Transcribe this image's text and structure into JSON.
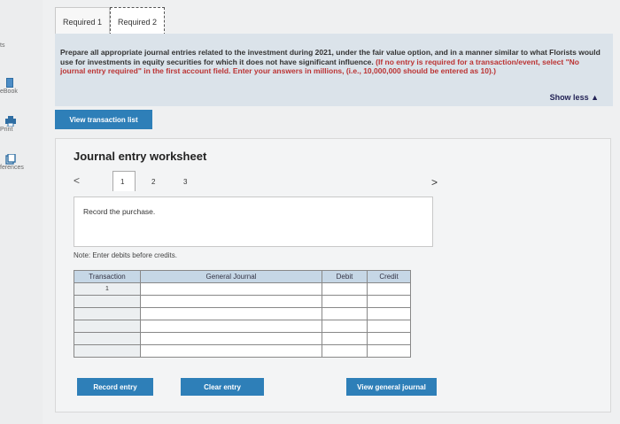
{
  "sidebar": {
    "top_text": "ts",
    "items": [
      {
        "label": "eBook",
        "icon": "book-icon"
      },
      {
        "label": "Print",
        "icon": "printer-icon"
      },
      {
        "label": "ferences",
        "icon": "references-icon"
      }
    ]
  },
  "tabs": [
    {
      "label": "Required 1",
      "active": false
    },
    {
      "label": "Required 2",
      "active": true
    }
  ],
  "instructions": {
    "main": "Prepare all appropriate journal entries related to the investment during 2021, under the fair value option, and in a manner similar to what Florists would use for investments in equity securities for which it does not have significant influence.",
    "note": "(If no entry is required for a transaction/event, select \"No journal entry required\" in the first account field. Enter your answers in millions, (i.e., 10,000,000 should be entered as 10).)"
  },
  "show_less": "Show less ▲",
  "view_transaction_button": "View transaction list",
  "worksheet": {
    "title": "Journal entry worksheet",
    "pages": [
      "1",
      "2",
      "3"
    ],
    "active_page": "1",
    "prev_symbol": "<",
    "next_symbol": ">",
    "record_text": "Record the purchase.",
    "note": "Note: Enter debits before credits."
  },
  "table": {
    "headers": [
      "Transaction",
      "General Journal",
      "Debit",
      "Credit"
    ],
    "rows": [
      {
        "transaction": "1"
      },
      {
        "transaction": ""
      },
      {
        "transaction": ""
      },
      {
        "transaction": ""
      },
      {
        "transaction": ""
      },
      {
        "transaction": ""
      }
    ]
  },
  "buttons": {
    "record_entry": "Record entry",
    "clear_entry": "Clear entry",
    "view_general_journal": "View general journal"
  },
  "colors": {
    "accent": "#2e7fb8",
    "instruction_bg": "#dbe3ea",
    "table_header_bg": "#c6d7e6",
    "warning_text": "#b33333"
  }
}
